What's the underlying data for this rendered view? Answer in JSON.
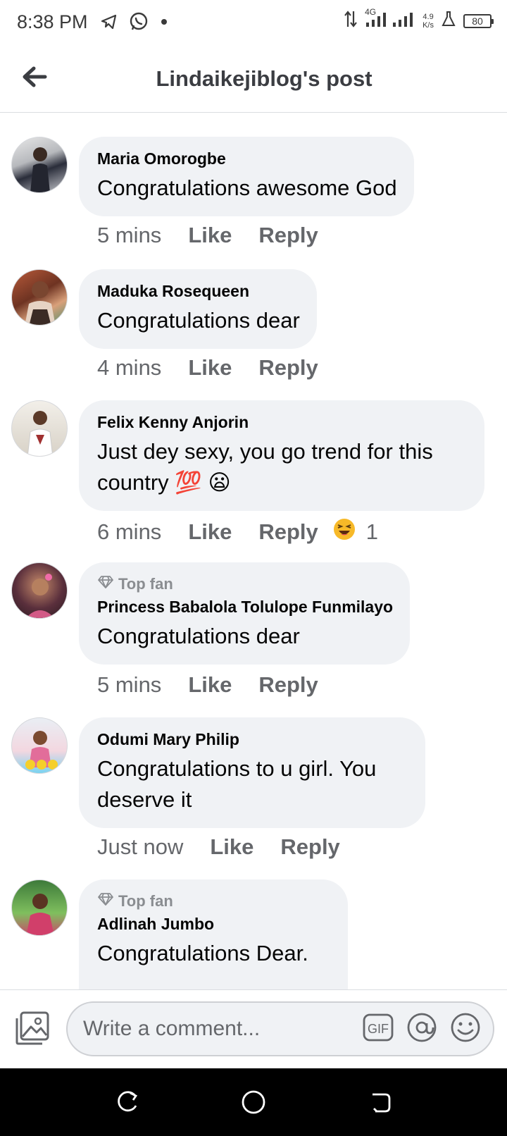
{
  "status_bar": {
    "time": "8:38 PM",
    "network": "4G",
    "speed_value": "4.9",
    "speed_unit": "K/s",
    "battery": "80",
    "icons": [
      "telegram-icon",
      "whatsapp-icon",
      "notification-dot-icon",
      "data-arrows-icon",
      "signal-icon",
      "lab-icon",
      "battery-icon"
    ]
  },
  "header": {
    "title": "Lindaikejiblog's post",
    "back_icon": "arrow-left-icon"
  },
  "comments": [
    {
      "author": "Maria Omorogbe",
      "text": "Congratulations awesome God",
      "time": "5 mins",
      "like": "Like",
      "reply": "Reply",
      "top_fan": false
    },
    {
      "author": "Maduka Rosequeen",
      "text": "Congratulations dear",
      "time": "4 mins",
      "like": "Like",
      "reply": "Reply",
      "top_fan": false
    },
    {
      "author": "Felix Kenny Anjorin",
      "text": "Just dey sexy, you go trend for this country 💯 😦",
      "time": "6 mins",
      "like": "Like",
      "reply": "Reply",
      "reaction_icon": "laughing-emoji-icon",
      "reaction_count": "1",
      "top_fan": false
    },
    {
      "author": "Princess Babalola Tolulope Funmilayo",
      "badge": "Top fan",
      "text": "Congratulations dear",
      "time": "5 mins",
      "like": "Like",
      "reply": "Reply",
      "top_fan": true
    },
    {
      "author": "Odumi Mary Philip",
      "text": "Congratulations to u girl. You deserve it",
      "time": "Just now",
      "like": "Like",
      "reply": "Reply",
      "top_fan": false
    },
    {
      "author": "Adlinah Jumbo",
      "badge": "Top fan",
      "text": "Congratulations Dear.",
      "top_fan": true
    }
  ],
  "comment_bar": {
    "placeholder": "Write a comment...",
    "icons": [
      "photo-icon",
      "gif-icon",
      "mention-icon",
      "emoji-icon"
    ]
  },
  "nav_bar": {
    "icons": [
      "recents-icon",
      "home-icon",
      "back-icon"
    ]
  },
  "colors": {
    "bubble": "#f0f2f5",
    "meta_text": "#65676b",
    "title_text": "#3b3d42"
  }
}
